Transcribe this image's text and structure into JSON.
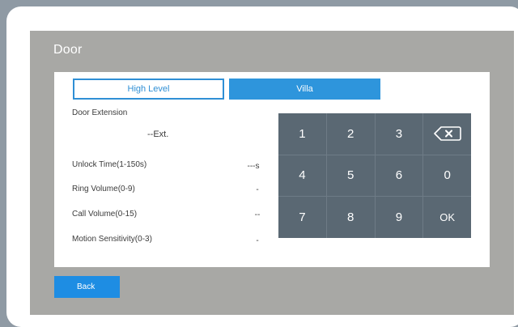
{
  "screen": {
    "title": "Door"
  },
  "tabs": [
    {
      "label": "High Level",
      "active": false
    },
    {
      "label": "Villa",
      "active": true
    }
  ],
  "fields": {
    "door_extension": {
      "label": "Door Extension",
      "value": "--Ext."
    },
    "unlock_time": {
      "label": "Unlock Time(1-150s)",
      "value": "---s"
    },
    "ring_volume": {
      "label": "Ring Volume(0-9)",
      "value": "-"
    },
    "call_volume": {
      "label": "Call Volume(0-15)",
      "value": "--"
    },
    "motion_sensitivity": {
      "label": "Motion Sensitivity(0-3)",
      "value": "-"
    }
  },
  "keypad": {
    "keys": [
      "1",
      "2",
      "3",
      "4",
      "5",
      "6",
      "0",
      "7",
      "8",
      "9",
      "OK"
    ],
    "backspace_icon": "backspace-icon"
  },
  "buttons": {
    "back": "Back"
  },
  "colors": {
    "accent": "#2e95dc",
    "keypad": "#5a6873",
    "screen_bg": "#a8a8a5"
  }
}
